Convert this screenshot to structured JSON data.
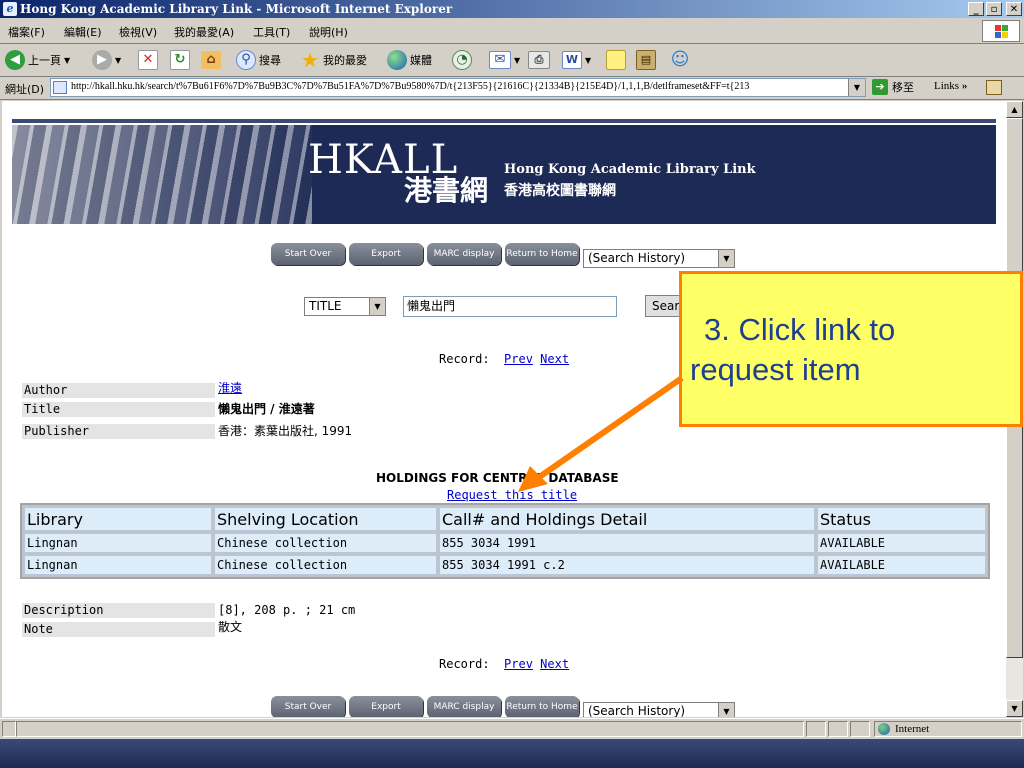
{
  "window": {
    "title": "Hong Kong Academic Library Link - Microsoft Internet Explorer",
    "minimize": "_",
    "restore": "▫",
    "close": "✕"
  },
  "menu": [
    "檔案(F)",
    "編輯(E)",
    "檢視(V)",
    "我的最愛(A)",
    "工具(T)",
    "說明(H)"
  ],
  "toolbar": {
    "back": "上一頁",
    "search": "搜尋",
    "favorites": "我的最愛",
    "media": "媒體"
  },
  "address": {
    "label": "網址(D)",
    "url": "http://hkall.hku.hk/search/t%7Bu61F6%7D%7Bu9B3C%7D%7Bu51FA%7D%7Bu9580%7D/t{213F55}{21616C}{21334B}{215E4D}/1,1,1,B/detlframeset&FF=t{213",
    "go": "移至",
    "links": "Links"
  },
  "banner": {
    "logo": "HKALL",
    "logo_zh": "港書網",
    "name_en": "Hong Kong Academic Library Link",
    "name_zh": "香港高校圖書聯網"
  },
  "buttons": {
    "start_over": "Start Over",
    "export": "Export",
    "marc": "MARC display",
    "return_home": "Return to Home",
    "history": "(Search History)"
  },
  "search": {
    "field": "TITLE",
    "value": "懶鬼出門",
    "button": "Sear"
  },
  "record": {
    "label": "Record:",
    "prev": "Prev",
    "next": "Next"
  },
  "fields": {
    "author_label": "Author",
    "author": "淮遠",
    "title_label": "Title",
    "title": "懶鬼出門 / 淮遠著",
    "publisher_label": "Publisher",
    "publisher": "香港：素葉出版社, 1991",
    "description_label": "Description",
    "description": "[8], 208 p. ; 21 cm",
    "note_label": "Note",
    "note": "散文"
  },
  "holdings": {
    "title": "HOLDINGS FOR CENTRAL DATABASE",
    "request": "Request this title",
    "columns": [
      "Library",
      "Shelving Location",
      "Call# and Holdings Detail",
      "Status"
    ],
    "rows": [
      [
        "Lingnan",
        "Chinese collection",
        "855 3034 1991",
        "AVAILABLE"
      ],
      [
        "Lingnan",
        "Chinese collection",
        "855 3034 1991 c.2",
        "AVAILABLE"
      ]
    ]
  },
  "callout": {
    "line1": "3. Click link to",
    "line2": "request item"
  },
  "status": {
    "zone": "Internet"
  },
  "colors": {
    "callout_bg": "#ffff66",
    "callout_border": "#ff8000",
    "callout_text": "#1f3f8f",
    "banner": "#1e2a56"
  }
}
